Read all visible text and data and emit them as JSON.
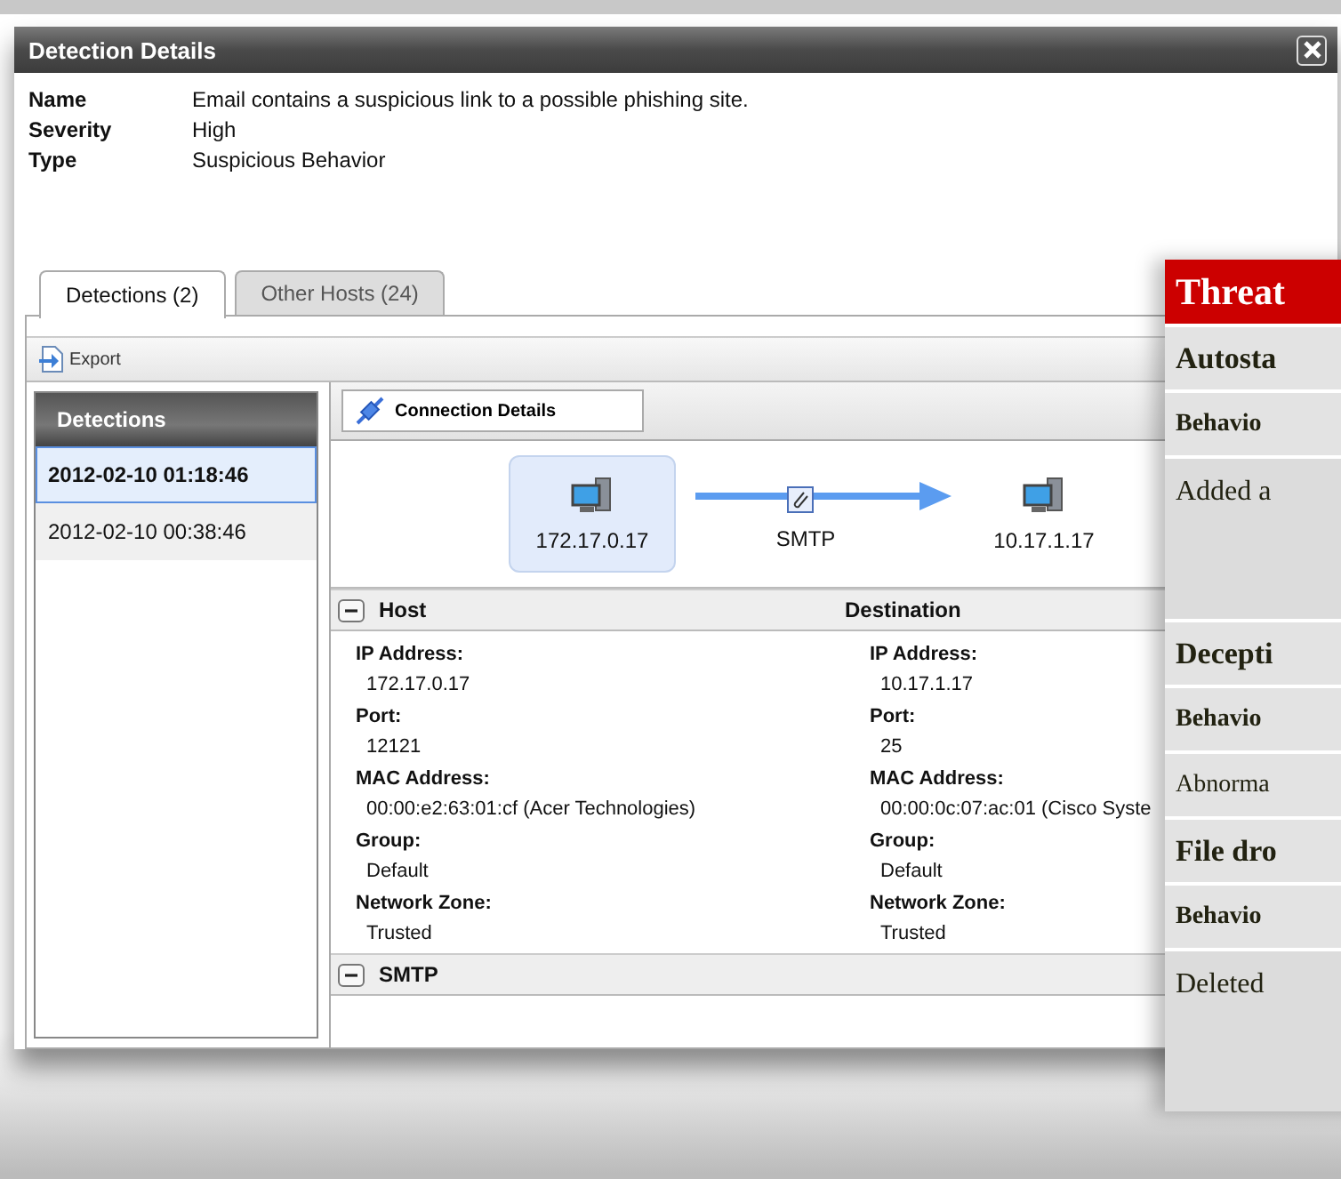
{
  "window": {
    "title": "Detection Details"
  },
  "summary": [
    {
      "label": "Name",
      "value": "Email contains a suspicious link to a possible phishing site."
    },
    {
      "label": "Severity",
      "value": "High"
    },
    {
      "label": "Type",
      "value": "Suspicious Behavior"
    }
  ],
  "tabs": [
    {
      "label": "Detections (2)",
      "selected": true
    },
    {
      "label": "Other Hosts (24)",
      "selected": false
    }
  ],
  "toolbar": {
    "export": "Export"
  },
  "detections_list": {
    "header": "Detections",
    "items": [
      {
        "time": "2012-02-10 01:18:46",
        "selected": true
      },
      {
        "time": "2012-02-10 00:38:46",
        "selected": false
      }
    ]
  },
  "connection_details": {
    "button": "Connection Details",
    "diagram": {
      "source": "172.17.0.17",
      "protocol": "SMTP",
      "destination": "10.17.1.17"
    },
    "sections": [
      {
        "title": "Host",
        "expanded": true,
        "column_2": "Destination",
        "fields": [
          {
            "host_label": "IP Address:",
            "host": "172.17.0.17",
            "destination_label": "IP Address:",
            "destination": "10.17.1.17"
          },
          {
            "host_label": "Port:",
            "host": "12121",
            "destination_label": "Port:",
            "destination": "25"
          },
          {
            "host_label": "MAC Address:",
            "host": "00:00:e2:63:01:cf (Acer Technologies)",
            "destination_label": "MAC Address:",
            "destination": "00:00:0c:07:ac:01 (Cisco Syste"
          },
          {
            "host_label": "Group:",
            "host": "Default",
            "destination_label": "Group:",
            "destination": "Default"
          },
          {
            "host_label": "Network Zone:",
            "host": "Trusted",
            "destination_label": "Network Zone:",
            "destination": "Trusted"
          }
        ]
      },
      {
        "title": "SMTP",
        "expanded": true
      }
    ]
  },
  "threat_panel": {
    "header": "Threat",
    "rows": [
      {
        "text": "Autosta",
        "kind": "title"
      },
      {
        "text": "Behavio",
        "kind": "label"
      },
      {
        "text": "Added a",
        "kind": "description"
      },
      {
        "text": "Decepti",
        "kind": "title"
      },
      {
        "text": "Behavio",
        "kind": "label"
      },
      {
        "text": "Abnorma",
        "kind": "note"
      },
      {
        "text": "File dro",
        "kind": "title"
      },
      {
        "text": "Behavio",
        "kind": "label"
      },
      {
        "text": "Deleted",
        "kind": "description"
      }
    ]
  }
}
